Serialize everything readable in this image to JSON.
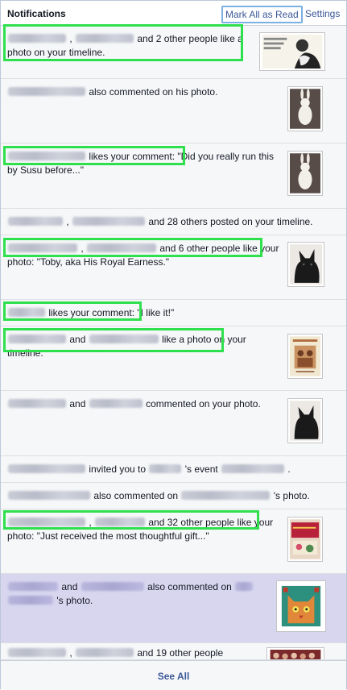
{
  "header": {
    "title": "Notifications",
    "mark_all_read": "Mark All as Read",
    "settings": "Settings"
  },
  "notifications": [
    {
      "t1": ",",
      "t2": "and 2 other people like a photo on your timeline."
    },
    {
      "t1": "also commented on his photo."
    },
    {
      "t1": "likes your comment: \"Did you really run this by Susu before...\""
    },
    {
      "t1": ",",
      "t2": "and 28 others posted on your timeline."
    },
    {
      "t1": ",",
      "t2": "and 6 other people like your photo: \"Toby, aka His Royal Earness.\""
    },
    {
      "t1": "likes your comment: \"I like it!\""
    },
    {
      "t1": "and",
      "t2": "like a photo on your timeline."
    },
    {
      "t1": "and",
      "t2": "commented on your photo."
    },
    {
      "t1": "invited you to",
      "t2": "'s event",
      "t3": "."
    },
    {
      "t1": "also commented on",
      "t2": "'s photo."
    },
    {
      "t1": ",",
      "t2": "and 32 other people like your photo: \"Just received the most thoughtful gift...\""
    },
    {
      "t1": "and",
      "t2": "also commented on",
      "t3": "'s photo."
    },
    {
      "t1": ",",
      "t2": "and 19 other people"
    }
  ],
  "footer": {
    "see_all": "See All"
  },
  "colors": {
    "link": "#3b5998",
    "highlight": "#2fe04e",
    "unread": "#d8d6ef"
  }
}
